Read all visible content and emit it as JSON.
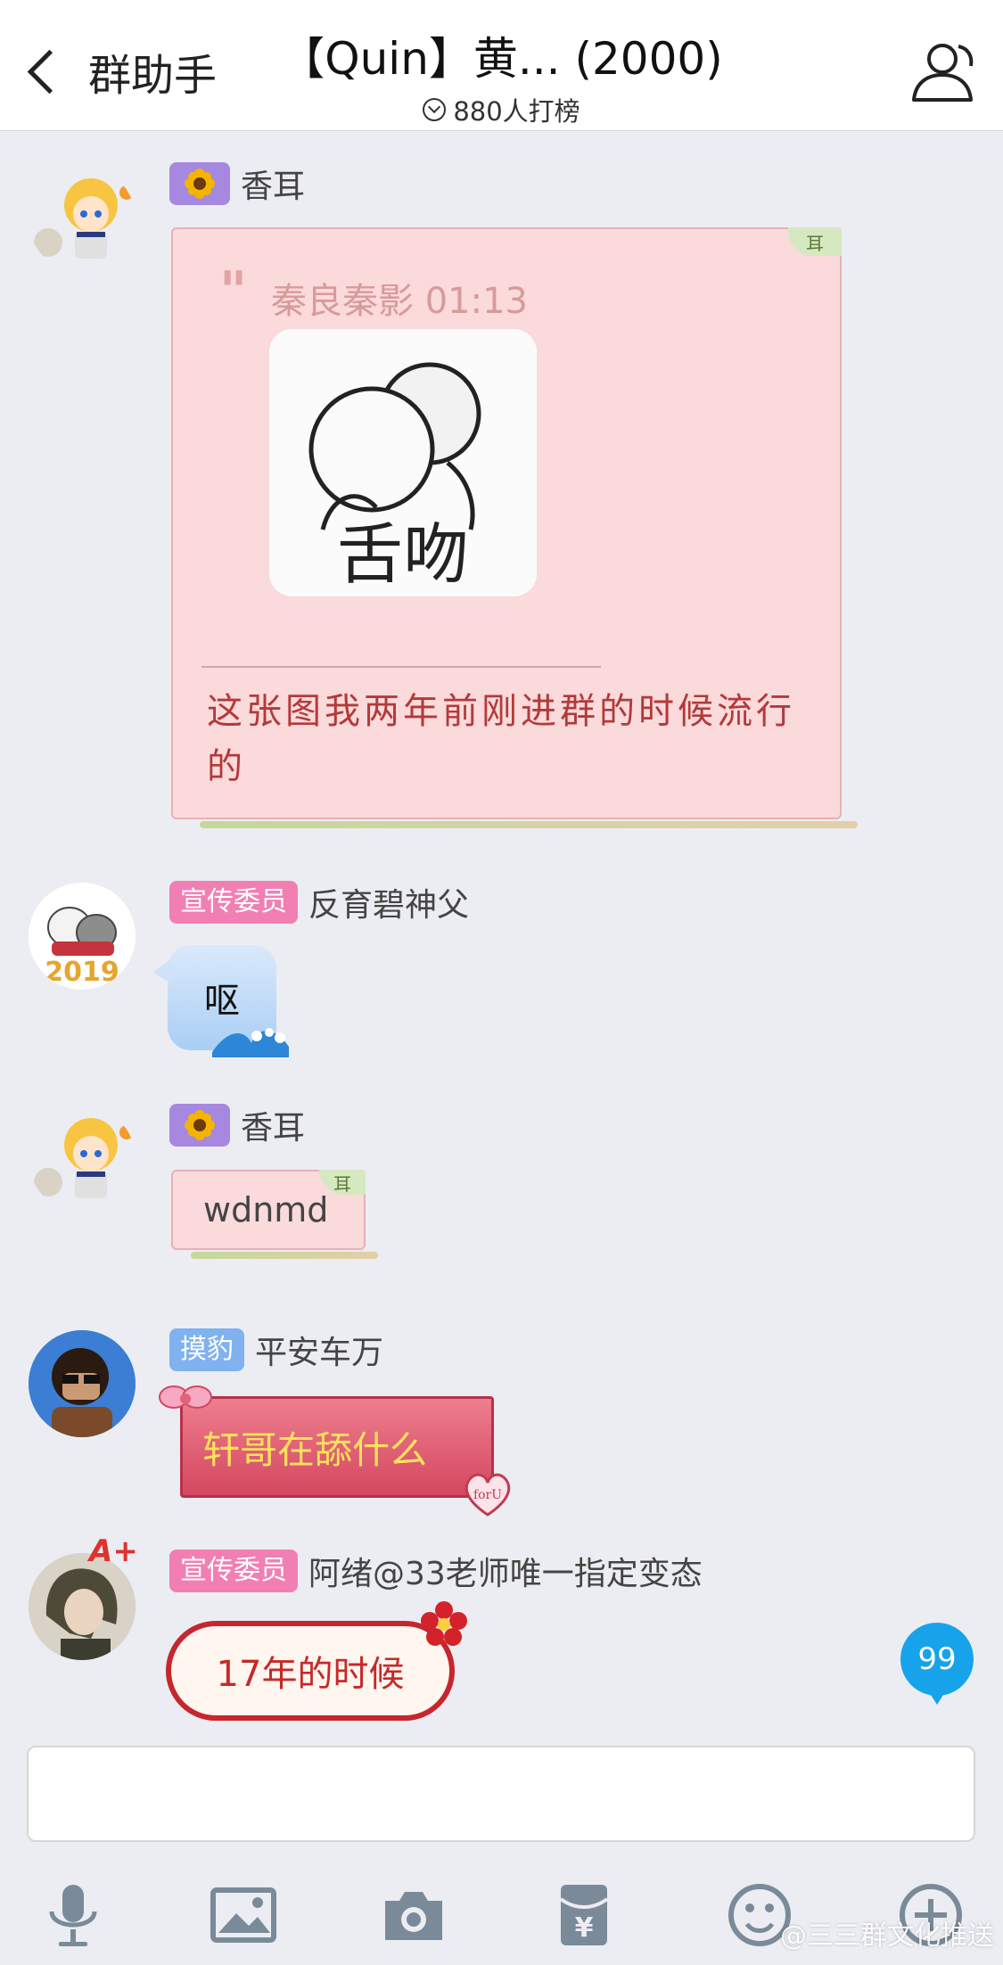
{
  "header": {
    "back_label": "群助手",
    "title": "【Quin】黄... (2000)",
    "subtitle": "880人打榜"
  },
  "messages": [
    {
      "badge_icon": "sunflower-icon",
      "sender": "香耳",
      "quote_author_time": "秦良秦影 01:13",
      "sticker_caption": "舌吻",
      "text": "这张图我两年前刚进群的时候流行的",
      "tag": "耳"
    },
    {
      "badge": "宣传委员",
      "sender": "反育碧神父",
      "avatar_label": "2019",
      "text": "呕"
    },
    {
      "badge_icon": "sunflower-icon",
      "sender": "香耳",
      "text": "wdnmd",
      "tag": "耳"
    },
    {
      "badge": "摸豹",
      "sender": "平安车万",
      "text": "轩哥在舔什么",
      "sticker_label": "forU"
    },
    {
      "badge": "宣传委员",
      "sender": "阿绪@33老师唯一指定变态",
      "avatar_label": "A+",
      "text": "17年的时候"
    }
  ],
  "unread_count": "99",
  "watermark": "@三三群文化推送",
  "colors": {
    "accent": "#17a3ea",
    "badge_pink": "#f27fb3",
    "badge_blue": "#7fb2ef",
    "badge_purple": "#a688e0",
    "background": "#ebedf2"
  }
}
